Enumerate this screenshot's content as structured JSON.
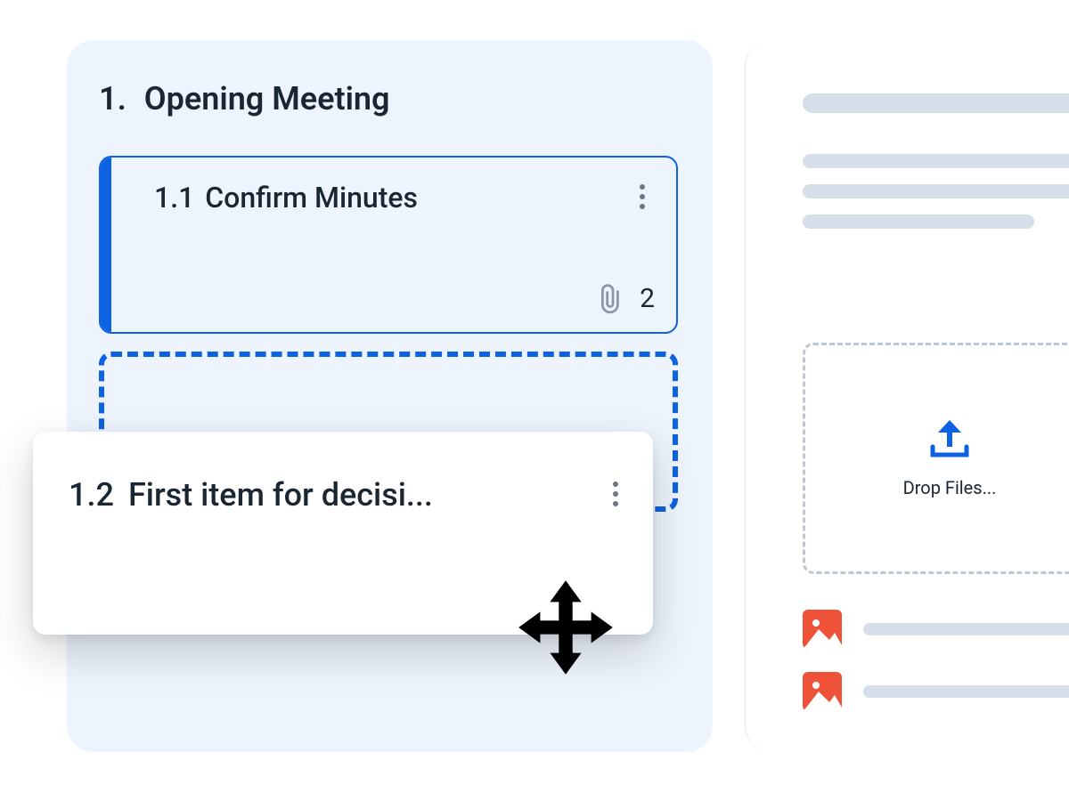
{
  "agenda": {
    "number": "1.",
    "title": "Opening Meeting",
    "items": [
      {
        "number": "1.1",
        "title": "Confirm Minutes",
        "attachments": "2"
      },
      {
        "number": "1.2",
        "title": "First item for decisi..."
      }
    ]
  },
  "sidebar": {
    "dropzone_label": "Drop Files..."
  }
}
